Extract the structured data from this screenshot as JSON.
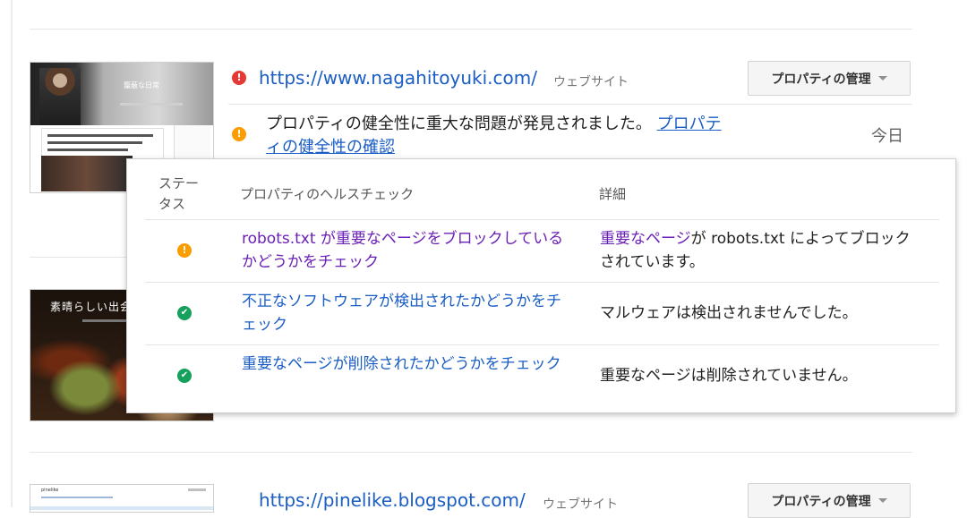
{
  "sites": [
    {
      "url": "https://www.nagahitoyuki.com/",
      "type": "ウェブサイト",
      "status": "error",
      "manage_label": "プロパティの管理",
      "thumbnail_title": "籠蔽な日常",
      "alert": {
        "message": "プロパティの健全性に重大な問題が発見されました。",
        "link": "プロパティの健全性の確認",
        "date": "今日"
      }
    },
    {
      "thumbnail_title": "素晴らしい出会"
    },
    {
      "url": "https://pinelike.blogspot.com/",
      "type": "ウェブサイト",
      "manage_label": "プロパティの管理",
      "thumbnail_logo": "pinelike"
    }
  ],
  "health_popup": {
    "headers": {
      "status": "ステータス",
      "check": "プロパティのヘルスチェック",
      "detail": "詳細"
    },
    "rows": [
      {
        "status": "warning",
        "check": "robots.txt が重要なページをブロックしているかどうかをチェック",
        "detail_link": "重要なページ",
        "detail": "が robots.txt によってブロックされています。"
      },
      {
        "status": "ok",
        "check": "不正なソフトウェアが検出されたかどうかをチェック",
        "detail": "マルウェアは検出されませんでした。"
      },
      {
        "status": "ok",
        "check": "重要なページが削除されたかどうかをチェック",
        "detail": "重要なページは削除されていません。"
      }
    ]
  },
  "colors": {
    "link": "#1a5dc4",
    "visited_link": "#6a1fb5",
    "error": "#e53935",
    "warning": "#fb9d00",
    "ok": "#15a05c"
  }
}
